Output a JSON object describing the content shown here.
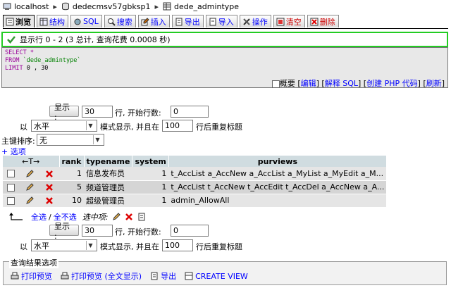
{
  "breadcrumb": {
    "server": "localhost",
    "database": "dedecmsv57gbksp1",
    "table": "dede_admintype"
  },
  "tabs": [
    {
      "label": "浏览",
      "icon": "browse-icon"
    },
    {
      "label": "结构",
      "icon": "structure-icon"
    },
    {
      "label": "SQL",
      "icon": "sql-icon"
    },
    {
      "label": "搜索",
      "icon": "search-icon"
    },
    {
      "label": "插入",
      "icon": "insert-icon"
    },
    {
      "label": "导出",
      "icon": "export-icon"
    },
    {
      "label": "导入",
      "icon": "import-icon"
    },
    {
      "label": "操作",
      "icon": "operations-icon"
    },
    {
      "label": "清空",
      "icon": "empty-icon"
    },
    {
      "label": "删除",
      "icon": "drop-icon"
    }
  ],
  "success": {
    "text": "显示行  0 - 2 (3 总计, 查询花费  0.0008 秒)"
  },
  "sql": {
    "select": "SELECT",
    "star": "*",
    "from": "FROM",
    "table": "`dede_admintype`",
    "limit": "LIMIT",
    "limit_vals": "0 , 30"
  },
  "sql_links": {
    "profile": "概要",
    "edit": "编辑",
    "explain": "解释 SQL",
    "create_php": "创建 PHP 代码",
    "refresh": "刷新"
  },
  "nav": {
    "show_button": "显示 :",
    "rows_value": "30",
    "rows_label": "行, 开始行数:",
    "start_value": "0",
    "in_label": "以",
    "mode_value": "水平",
    "mode_label": "模式显示, 并且在",
    "repeat_value": "100",
    "repeat_label": "行后重复标题"
  },
  "sort": {
    "label": "主键排序:",
    "value": "无",
    "options_link": "+ 选项"
  },
  "table": {
    "nav_arrows": "←T→",
    "columns": [
      "rank",
      "typename",
      "system",
      "purviews"
    ],
    "rows": [
      {
        "rank": "1",
        "typename": "信息发布员",
        "system": "1",
        "purviews": "t_AccList a_AccNew a_AccList a_MyList a_MyEdit a_M..."
      },
      {
        "rank": "5",
        "typename": "频道管理员",
        "system": "1",
        "purviews": "t_AccList t_AccNew t_AccEdit t_AccDel a_AccNew a_A..."
      },
      {
        "rank": "10",
        "typename": "超级管理员",
        "system": "1",
        "purviews": "admin_AllowAll"
      }
    ]
  },
  "bulk": {
    "check_all": "全选",
    "slash": "/",
    "uncheck_all": "全不选",
    "with_selected": "选中项:"
  },
  "results_ops": {
    "title": "查询结果选项",
    "print": "打印预览",
    "print_full": "打印预览 (全文显示)",
    "export": "导出",
    "create_view": "CREATE VIEW"
  },
  "colors": {
    "link": "#0000ff",
    "success_border": "#22cc22",
    "header_bg": "#d0dce0",
    "row_odd": "#e5e5e5",
    "row_even": "#d5d5d5"
  }
}
